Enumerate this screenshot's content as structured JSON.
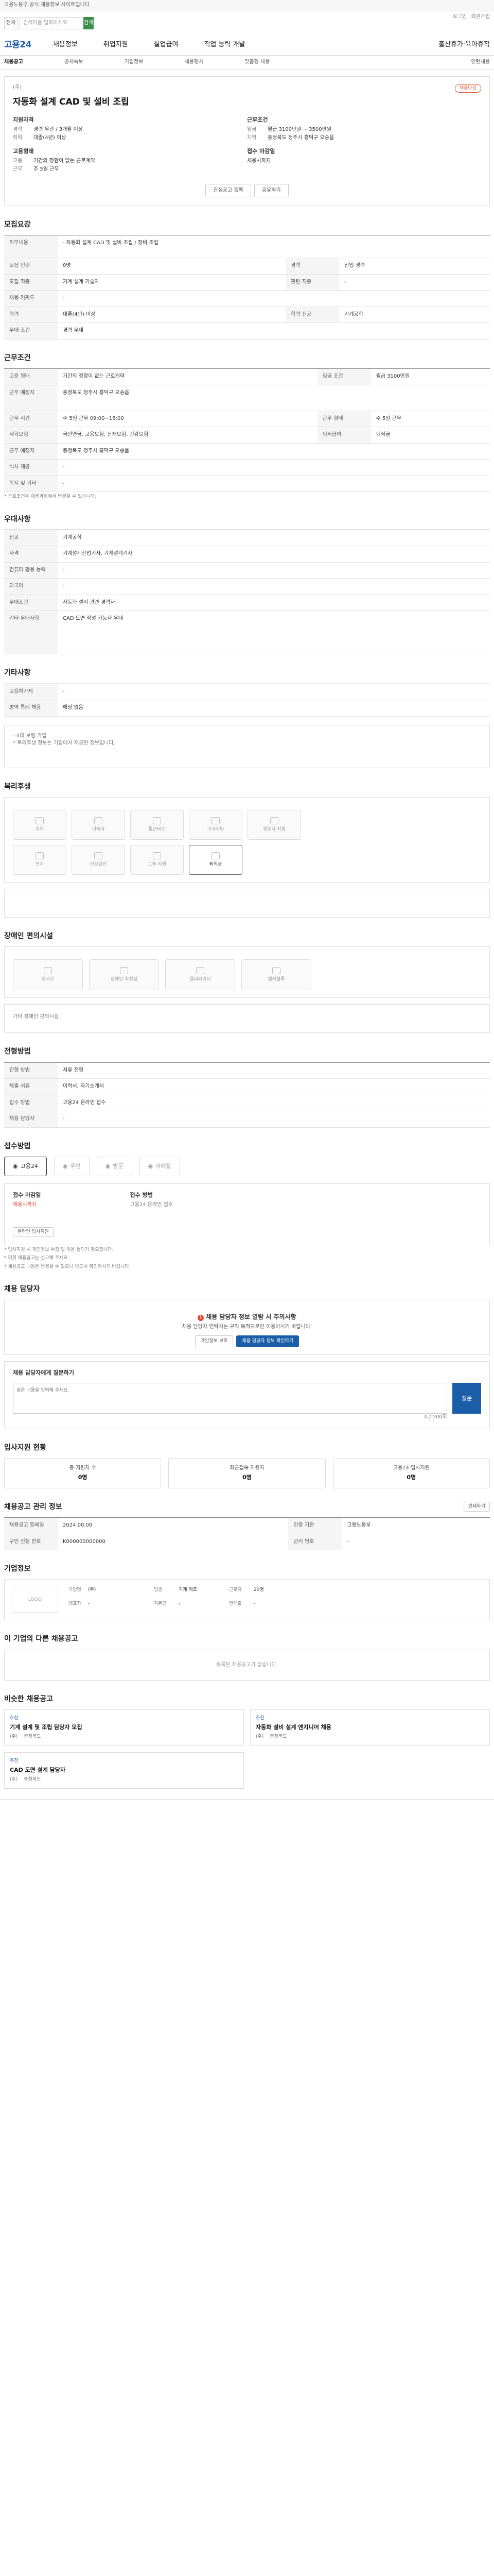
{
  "topbar": {
    "text": "고용노동부 공식 채용정보 사이트입니다"
  },
  "search": {
    "type": "전체",
    "placeholder": "검색어를 입력하세요",
    "button": "검색",
    "util": [
      "로그인",
      "회원가입"
    ]
  },
  "gnb": {
    "logo": "고용24",
    "menus": [
      "채용정보",
      "취업지원",
      "실업급여",
      "직업 능력 개발",
      "출산휴가·육아휴직"
    ]
  },
  "tabs": [
    "채용공고",
    "공채속보",
    "기업정보",
    "채용행사",
    "맞춤형 채용",
    "인턴채용"
  ],
  "job": {
    "company": "(주)",
    "badge": "채용마감",
    "title": "자동화 설계 CAD 및 설비 조립",
    "left_label": "지원자격",
    "left": [
      [
        "경력",
        "경력 무관 / 3개월 이상"
      ],
      [
        "학력",
        "대졸(4년) 이상"
      ]
    ],
    "left2_label": "고용형태",
    "left2": [
      [
        "고용",
        "기간의 정함이 없는 근로계약"
      ],
      [
        "근무",
        "주 5일 근무"
      ]
    ],
    "right_label": "근무조건",
    "right": [
      [
        "임금",
        "월급 3100만원 ~ 3500만원"
      ],
      [
        "지역",
        "충청북도 청주시 흥덕구 오송읍"
      ]
    ],
    "right2_label": "접수 마감일",
    "right2": "채용시까지",
    "btn_save": "관심공고 등록",
    "btn_share": "공유하기"
  },
  "duty": {
    "h": "모집요강",
    "th": "직무내용",
    "td": "- 자동화 설계 CAD 및 설비 조립 / 장비 조립",
    "rows": [
      [
        "모집 인원",
        "0명",
        "경력",
        "신입·경력"
      ],
      [
        "모집 직종",
        "기계 설계 기술자",
        "관련 직종",
        "-"
      ],
      [
        "채용 키워드",
        "-",
        "",
        ""
      ],
      [
        "학력",
        "대졸(4년) 이상",
        "학력 전공",
        "기계공학"
      ],
      [
        "우대 조건",
        "경력 우대",
        "",
        ""
      ]
    ]
  },
  "cond": {
    "h": "근무조건",
    "rows": [
      [
        "고용 형태",
        "기간의 정함이 없는 근로계약",
        "임금 조건",
        "월급 3100만원"
      ],
      [
        "근무 예정지",
        "충청북도 청주시 흥덕구 오송읍",
        "",
        ""
      ],
      [
        "근무 시간",
        "주 5일 근무 09:00~18:00",
        "근무 형태",
        "주 5일 근무"
      ],
      [
        "사회보험",
        "국민연금, 고용보험, 산재보험, 건강보험",
        "퇴직급여",
        "퇴직금"
      ],
      [
        "근무 예정지",
        "충청북도 청주시 흥덕구 오송읍",
        "",
        ""
      ],
      [
        "식사 제공",
        "-",
        "",
        ""
      ],
      [
        "복지 및 기타",
        "-",
        "",
        ""
      ]
    ],
    "note": "* 근로조건은 채용과정에서 변경될 수 있습니다."
  },
  "pref": {
    "h": "우대사항",
    "rows": [
      [
        "전공",
        "기계공학"
      ],
      [
        "자격",
        "기계설계산업기사, 기계설계기사"
      ],
      [
        "컴퓨터 활용 능력",
        "-"
      ],
      [
        "외국어",
        "-"
      ],
      [
        "우대조건",
        "자동화 설비 관련 경력자"
      ],
      [
        "기타 우대사항",
        "CAD 도면 작성 가능자 우대"
      ]
    ]
  },
  "etc": {
    "h": "기타사항",
    "rows": [
      [
        "고용허가제",
        "-"
      ],
      [
        "병역 특례 채용",
        "해당 없음"
      ]
    ]
  },
  "fac": {
    "h": "복리후생",
    "note1": "- 4대 보험 가입",
    "note2": "* 복리후생 정보는 기업에서 제공한 정보입니다.",
    "chips": [
      "주차",
      "기숙사",
      "통근버스",
      "구내식당",
      "경조사 지원",
      "연차",
      "건강검진",
      "교육 지원",
      "퇴직금"
    ],
    "active": 8
  },
  "disab": {
    "h": "장애인 편의시설",
    "chips": [
      "경사로",
      "장애인 화장실",
      "엘리베이터",
      "점자블록"
    ],
    "sub": "기타 장애인 편의시설"
  },
  "proc": {
    "h": "전형방법",
    "rows": [
      [
        "전형 방법",
        "서류 전형",
        "",
        ""
      ],
      [
        "제출 서류",
        "이력서, 자기소개서",
        "",
        ""
      ],
      [
        "접수 방법",
        "고용24 온라인 접수",
        "",
        ""
      ],
      [
        "채용 담당자",
        "-",
        "",
        ""
      ]
    ]
  },
  "applyh": {
    "h": "접수방법",
    "items": [
      "고용24",
      "우편",
      "방문",
      "이메일"
    ],
    "active": 0
  },
  "recv": {
    "label1": "접수 마감일",
    "v1": "채용시까지",
    "label2": "접수 방법",
    "v2": "고용24 온라인 접수",
    "btn": "온라인 입사지원"
  },
  "notes": [
    "* 입사지원 시 개인정보 수집 및 이용 동의가 필요합니다.",
    "* 허위 채용공고는 신고해 주세요.",
    "* 채용공고 내용은 변경될 수 있으니 반드시 확인하시기 바랍니다."
  ],
  "contact": {
    "h": "채용 담당자",
    "title": "채용 담당자 정보 열람 시 주의사항",
    "body": "채용 담당자 연락처는 구직 목적으로만 이용하시기 바랍니다.",
    "b1": "개인정보 보호",
    "b2": "채용 담당자 정보 확인하기"
  },
  "ask": {
    "label": "채용 담당자에게 질문하기",
    "placeholder": "질문 내용을 입력해 주세요.",
    "btn": "질문",
    "count": "0 / 500자"
  },
  "stats": {
    "h": "입사지원 현황",
    "items": [
      [
        "총 지원자 수",
        "0명"
      ],
      [
        "최근접속 지원자",
        "0명"
      ],
      [
        "고용24 입사지원",
        "0명"
      ]
    ]
  },
  "info": {
    "h": "채용공고 관리 정보",
    "btn": "인쇄하기",
    "rows": [
      [
        "채용공고 등록일",
        "2024.00.00",
        "인증 기관",
        "고용노동부"
      ],
      [
        "구인 신청 번호",
        "K000000000000",
        "관리 번호",
        "-"
      ]
    ]
  },
  "comp": {
    "h": "기업정보",
    "logo": "LOGO",
    "fields": [
      "기업명",
      "(주)",
      "업종",
      "기계 제조",
      "근로자",
      "20명",
      "대표자",
      "-",
      "자본금",
      "-",
      "연매출",
      "-"
    ]
  },
  "others": {
    "h": "이 기업의 다른 채용공고",
    "empty": "등록된 채용공고가 없습니다."
  },
  "recs": {
    "h": "비슷한 채용공고",
    "items": [
      {
        "tag": "추천",
        "title": "기계 설계 및 조립 담당자 모집",
        "co": "(주)",
        "loc": "충청북도"
      },
      {
        "tag": "추천",
        "title": "자동화 설비 설계 엔지니어 채용",
        "co": "(주)",
        "loc": "충청북도"
      },
      {
        "tag": "추천",
        "title": "CAD 도면 설계 담당자",
        "co": "(주)",
        "loc": "충청북도"
      }
    ]
  }
}
